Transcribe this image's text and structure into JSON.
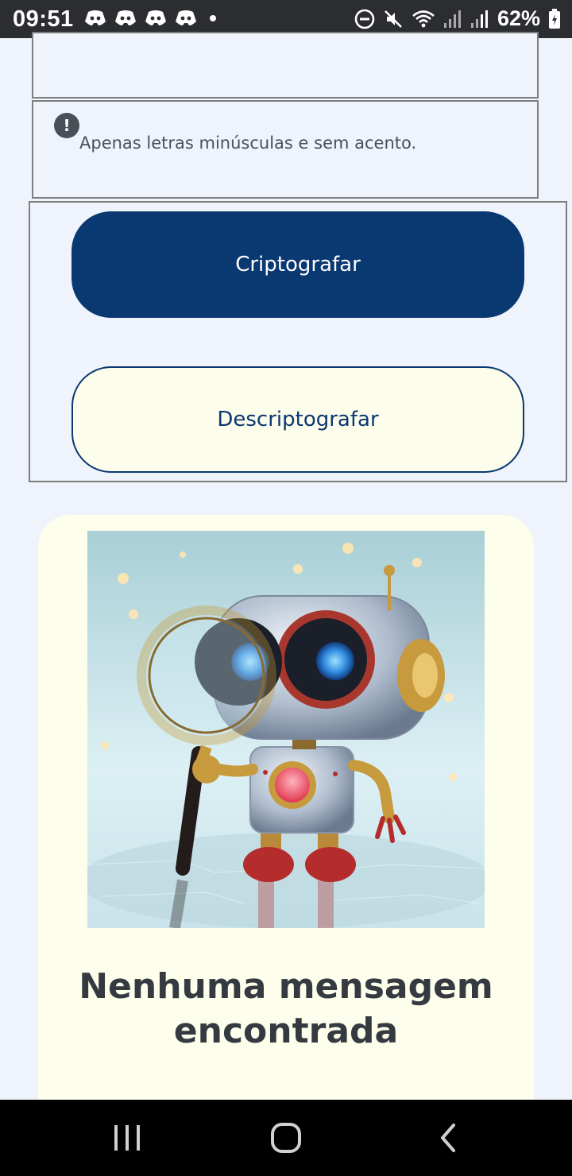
{
  "status_bar": {
    "time": "09:51",
    "battery": "62%",
    "icons": [
      "discord-icon",
      "discord-icon",
      "discord-icon",
      "discord-icon",
      "dot-icon",
      "dnd-icon",
      "mute-icon",
      "wifi-icon",
      "signal-icon",
      "signal-icon",
      "battery-icon"
    ]
  },
  "form": {
    "hint_icon": "exclamation-icon",
    "hint_text": "Apenas letras minúsculas e sem acento."
  },
  "buttons": {
    "encrypt_label": "Criptografar",
    "decrypt_label": "Descriptografar"
  },
  "result": {
    "image": "robot-magnifying-glass-illustration",
    "title": "Nenhuma mensagem encontrada"
  },
  "nav_bar": {
    "icons": [
      "recent-apps-icon",
      "home-icon",
      "back-icon"
    ]
  },
  "colors": {
    "page_bg": "#eff3fc",
    "primary": "#0a3871",
    "card_bg": "#fdfeec",
    "title_text": "#343a40",
    "hint_text": "#495057"
  }
}
